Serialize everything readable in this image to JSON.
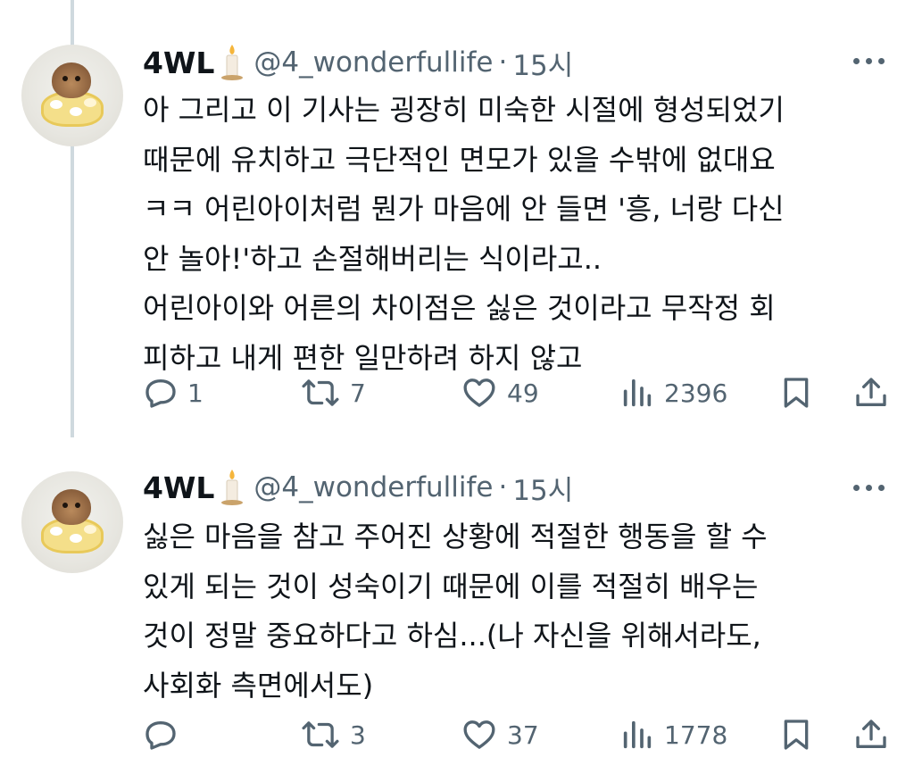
{
  "tweets": [
    {
      "name": "4WL",
      "handle": "@4_wonderfullife",
      "separator": "·",
      "time": "15시",
      "lines": [
        "아 그리고 이 기사는 굉장히 미숙한 시절에 형성되었기",
        "때문에 유치하고 극단적인 면모가 있을 수밖에 없대요",
        "ㅋㅋ 어린아이처럼 뭔가 마음에 안 들면 '흥, 너랑 다신",
        "안 놀아!'하고 손절해버리는 식이라고..",
        "어린아이와 어른의 차이점은 싫은 것이라고 무작정 회",
        "피하고 내게 편한 일만하려 하지 않고"
      ],
      "actions": {
        "replies": "1",
        "retweets": "7",
        "likes": "49",
        "views": "2396"
      }
    },
    {
      "name": "4WL",
      "handle": "@4_wonderfullife",
      "separator": "·",
      "time": "15시",
      "lines": [
        "싫은 마음을 참고 주어진 상황에 적절한 행동을 할 수",
        "있게 되는 것이 성숙이기 때문에 이를 적절히 배우는",
        "것이 정말 중요하다고 하심...(나 자신을 위해서라도,",
        "사회화 측면에서도)"
      ],
      "actions": {
        "replies": "",
        "retweets": "3",
        "likes": "37",
        "views": "1778"
      }
    }
  ],
  "icons": {
    "more": "more-dots-icon",
    "reply": "reply-icon",
    "retweet": "retweet-icon",
    "like": "heart-icon",
    "views": "views-chart-icon",
    "bookmark": "bookmark-icon",
    "share": "share-icon",
    "emoji": "candle-icon"
  },
  "colors": {
    "text": "#0f1419",
    "secondary": "#536471",
    "thread_line": "#cfd9de"
  }
}
